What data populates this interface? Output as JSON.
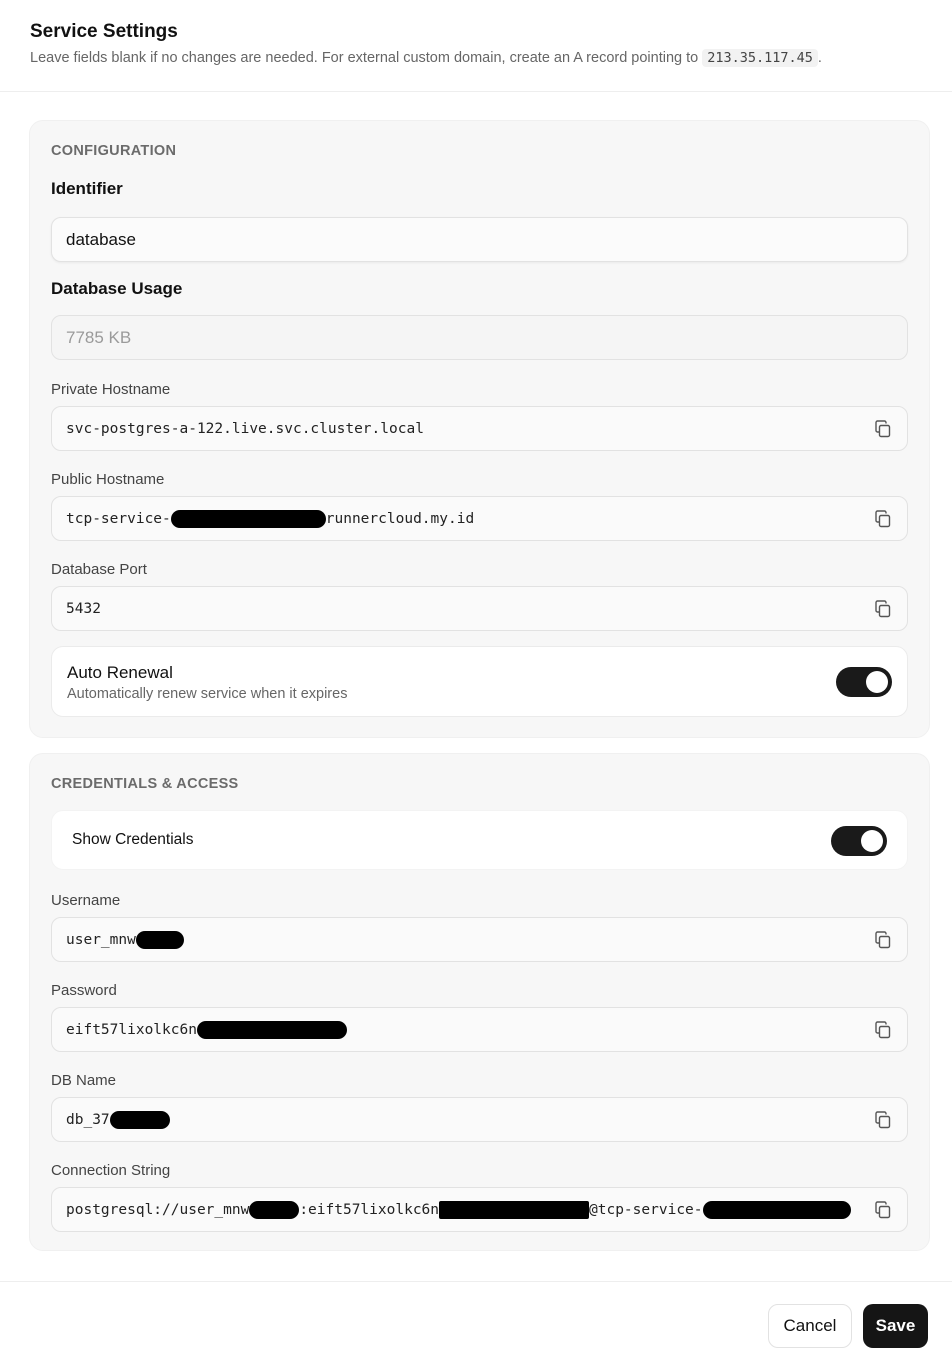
{
  "header": {
    "title": "Service Settings",
    "subtitle": "Leave fields blank if no changes are needed. For external custom domain, create an A record pointing to",
    "ip": "213.35.117.45",
    "suffix": "."
  },
  "configuration": {
    "heading": "CONFIGURATION",
    "identifier": {
      "label": "Identifier",
      "value": "database"
    },
    "database_usage": {
      "label": "Database Usage",
      "value": "7785 KB"
    },
    "private_hostname": {
      "label": "Private Hostname",
      "value": "svc-postgres-a-122.live.svc.cluster.local"
    },
    "public_hostname": {
      "label": "Public Hostname",
      "prefix": "tcp-service-",
      "suffix": "runnercloud.my.id"
    },
    "database_port": {
      "label": "Database Port",
      "value": "5432"
    },
    "auto_renewal": {
      "title": "Auto Renewal",
      "description": "Automatically renew service when it expires",
      "enabled": true
    }
  },
  "credentials": {
    "heading": "CREDENTIALS & ACCESS",
    "show_credentials": {
      "label": "Show Credentials",
      "enabled": true
    },
    "username": {
      "label": "Username",
      "prefix": "user_mnw"
    },
    "password": {
      "label": "Password",
      "prefix": "eift57lixolkc6n"
    },
    "db_name": {
      "label": "DB Name",
      "prefix": "db_37"
    },
    "connection_string": {
      "label": "Connection String",
      "part1": "postgresql://user_mnw",
      "part2": ":eift57lixolkc6n",
      "part3": "@tcp-service-"
    }
  },
  "footer": {
    "cancel_label": "Cancel",
    "save_label": "Save"
  },
  "icons": {
    "copy": "copy-icon"
  }
}
